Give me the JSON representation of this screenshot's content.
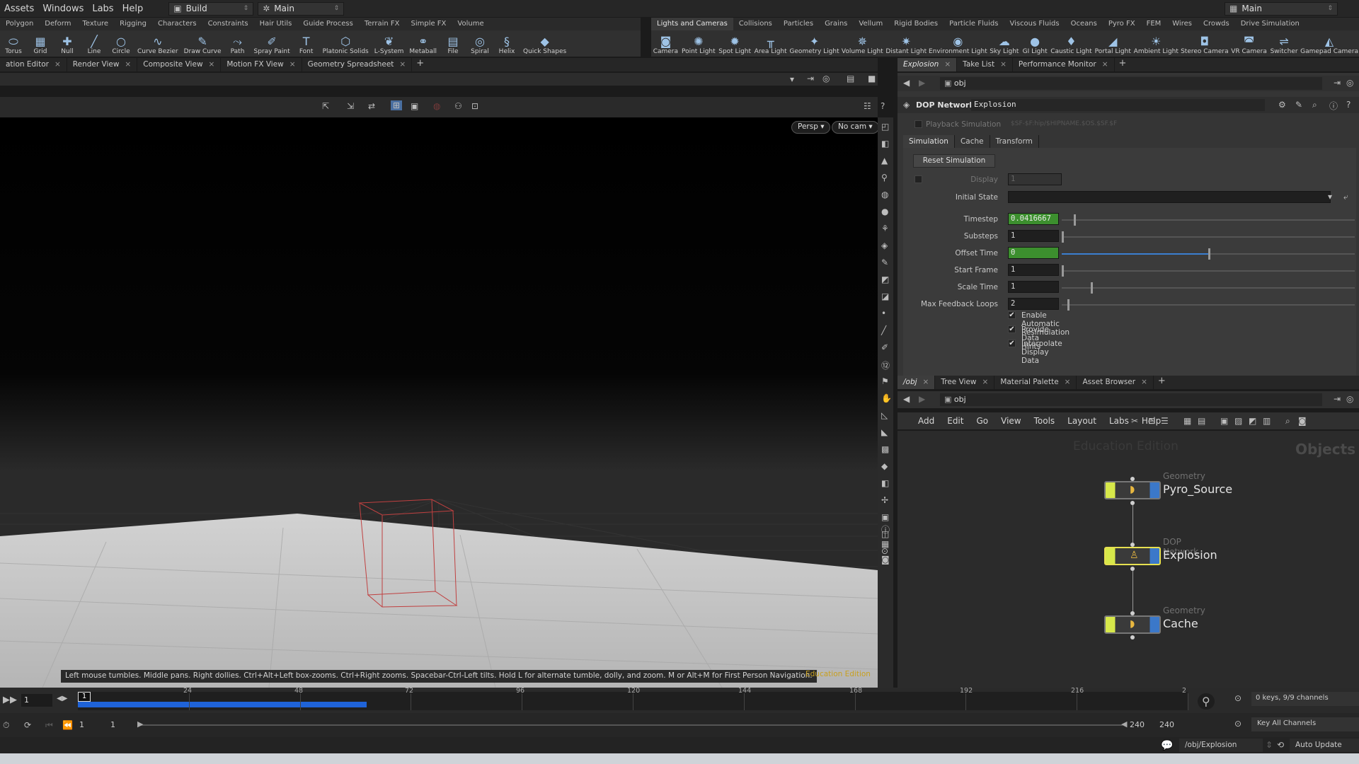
{
  "menubar": {
    "items": [
      "Assets",
      "Windows",
      "Labs",
      "Help"
    ],
    "desktop": "Build",
    "workspace": "Main",
    "right_desktop": "Main"
  },
  "shelf_left": {
    "tabs": [
      "Polygon",
      "Deform",
      "Texture",
      "Rigging",
      "Characters",
      "Constraints",
      "Hair Utils",
      "Guide Process",
      "Terrain FX",
      "Simple FX",
      "Volume"
    ],
    "tools": [
      {
        "label": "Torus",
        "icon": "torus-icon"
      },
      {
        "label": "Grid",
        "icon": "grid-icon"
      },
      {
        "label": "Null",
        "icon": "null-icon"
      },
      {
        "label": "Line",
        "icon": "line-icon"
      },
      {
        "label": "Circle",
        "icon": "circle-icon"
      },
      {
        "label": "Curve Bezier",
        "icon": "curve-bezier-icon"
      },
      {
        "label": "Draw Curve",
        "icon": "draw-curve-icon"
      },
      {
        "label": "Path",
        "icon": "path-icon"
      },
      {
        "label": "Spray Paint",
        "icon": "spray-paint-icon"
      },
      {
        "label": "Font",
        "icon": "font-icon"
      },
      {
        "label": "Platonic Solids",
        "icon": "platonic-icon"
      },
      {
        "label": "L-System",
        "icon": "lsystem-icon"
      },
      {
        "label": "Metaball",
        "icon": "metaball-icon"
      },
      {
        "label": "File",
        "icon": "file-icon"
      },
      {
        "label": "Spiral",
        "icon": "spiral-icon"
      },
      {
        "label": "Helix",
        "icon": "helix-icon"
      },
      {
        "label": "Quick Shapes",
        "icon": "quick-shapes-icon"
      }
    ]
  },
  "shelf_right": {
    "tabs": [
      "Lights and Cameras",
      "Collisions",
      "Particles",
      "Grains",
      "Vellum",
      "Rigid Bodies",
      "Particle Fluids",
      "Viscous Fluids",
      "Oceans",
      "Pyro FX",
      "FEM",
      "Wires",
      "Crowds",
      "Drive Simulation"
    ],
    "tools": [
      {
        "label": "Camera",
        "icon": "camera-icon"
      },
      {
        "label": "Point Light",
        "icon": "point-light-icon"
      },
      {
        "label": "Spot Light",
        "icon": "spot-light-icon"
      },
      {
        "label": "Area Light",
        "icon": "area-light-icon"
      },
      {
        "label": "Geometry Light",
        "icon": "geometry-light-icon"
      },
      {
        "label": "Volume Light",
        "icon": "volume-light-icon"
      },
      {
        "label": "Distant Light",
        "icon": "distant-light-icon"
      },
      {
        "label": "Environment Light",
        "icon": "environment-light-icon"
      },
      {
        "label": "Sky Light",
        "icon": "sky-light-icon"
      },
      {
        "label": "GI Light",
        "icon": "gi-light-icon"
      },
      {
        "label": "Caustic Light",
        "icon": "caustic-light-icon"
      },
      {
        "label": "Portal Light",
        "icon": "portal-light-icon"
      },
      {
        "label": "Ambient Light",
        "icon": "ambient-light-icon"
      },
      {
        "label": "Stereo Camera",
        "icon": "stereo-camera-icon"
      },
      {
        "label": "VR Camera",
        "icon": "vr-camera-icon"
      },
      {
        "label": "Switcher",
        "icon": "switcher-icon"
      },
      {
        "label": "Gamepad Camera",
        "icon": "gamepad-camera-icon"
      }
    ]
  },
  "left_panes": {
    "tabs": [
      "ation Editor",
      "Render View",
      "Composite View",
      "Motion FX View",
      "Geometry Spreadsheet"
    ]
  },
  "viewport": {
    "persp": "Persp",
    "cam": "No cam",
    "hint": "Left mouse tumbles. Middle pans. Right dollies. Ctrl+Alt+Left box-zooms. Ctrl+Right zooms. Spacebar-Ctrl-Left tilts. Hold L for alternate tumble, dolly, and zoom. M or Alt+M for First Person Navigation.",
    "edition": "Education Edition"
  },
  "right_panes": {
    "tabs": [
      "Explosion",
      "Take List",
      "Performance Monitor"
    ],
    "path": "obj"
  },
  "params": {
    "node_type": "DOP Network",
    "node_name": "Explosion",
    "playback_label": "Playback Simulation",
    "playback_value": "$SF-$F:hip/$HIPNAME.$OS.$SF.$F",
    "tabs": [
      "Simulation",
      "Cache",
      "Transform"
    ],
    "reset_button": "Reset Simulation",
    "display_label": "Display",
    "display_value": "1",
    "initial_state_label": "Initial State",
    "fields": [
      {
        "label": "Timestep",
        "value": "0.0416667",
        "green": true,
        "handle": 0.04
      },
      {
        "label": "Substeps",
        "value": "1",
        "green": false,
        "handle": 0.0
      },
      {
        "label": "Offset Time",
        "value": "0",
        "green": true,
        "handle": 0.5
      },
      {
        "label": "Start Frame",
        "value": "1",
        "green": false,
        "handle": 0.0
      },
      {
        "label": "Scale Time",
        "value": "1",
        "green": false,
        "handle": 0.1
      },
      {
        "label": "Max Feedback Loops",
        "value": "2",
        "green": false,
        "handle": 0.02
      }
    ],
    "checks": [
      "Enable Automatic Resimulation",
      "Provide Data Hints",
      "Interpolate Display Data"
    ]
  },
  "network_panes": {
    "tabs": [
      "/obj",
      "Tree View",
      "Material Palette",
      "Asset Browser"
    ],
    "path": "obj",
    "menu": [
      "Add",
      "Edit",
      "Go",
      "View",
      "Tools",
      "Layout",
      "Labs",
      "Help"
    ],
    "watermark": "Education Edition",
    "context": "Objects",
    "nodes": [
      {
        "type": "Geometry",
        "name": "Pyro_Source",
        "selected": false
      },
      {
        "type": "DOP Network",
        "name": "Explosion",
        "selected": true
      },
      {
        "type": "Geometry",
        "name": "Cache",
        "selected": false
      }
    ]
  },
  "timeline": {
    "current_frame": "1",
    "ticks": [
      "24",
      "48",
      "72",
      "96",
      "120",
      "144",
      "168",
      "192",
      "216",
      "2"
    ],
    "cached_fraction": 0.26,
    "range_start": "1",
    "range_start2": "1",
    "range_end": "240",
    "range_end2": "240",
    "keys_info": "0 keys, 9/9 channels",
    "key_all": "Key All Channels"
  },
  "status": {
    "path": "/obj/Explosion",
    "update": "Auto Update"
  },
  "colors": {
    "accent_green": "#3c8f2e",
    "cache_blue": "#1f63d8",
    "edu_gold": "#c8a020"
  }
}
